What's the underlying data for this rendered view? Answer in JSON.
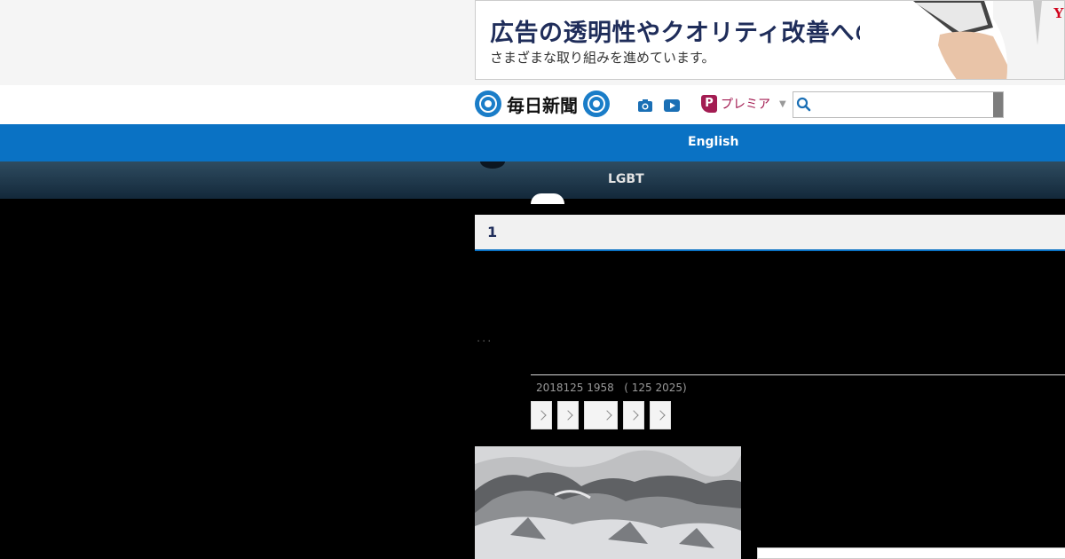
{
  "ad": {
    "headline": "広告の透明性やクオリティ改善への",
    "subline": "さまざまな取り組みを進めています。",
    "logo_text": "Y"
  },
  "header": {
    "logo_text": "毎日新聞",
    "camera_icon": "camera-icon",
    "video_icon": "video-play-icon",
    "premier_badge": "P",
    "premier_label": "プレミア",
    "premier_caret": "▼",
    "search_icon": "search-icon",
    "search_value": ""
  },
  "nav": {
    "primary_label": "English",
    "secondary_label": "LGBT"
  },
  "article": {
    "heading": "1",
    "ellipsis": "...",
    "dateline": "2018125 1958   ( 125 2025)",
    "share_buttons": [
      "",
      "",
      "",
      "",
      ""
    ]
  },
  "colors": {
    "nav_blue": "#0a72c4",
    "nav_dark": "#1f3a4e",
    "premier": "#a31c52",
    "heading_text": "#1f2d5a"
  }
}
